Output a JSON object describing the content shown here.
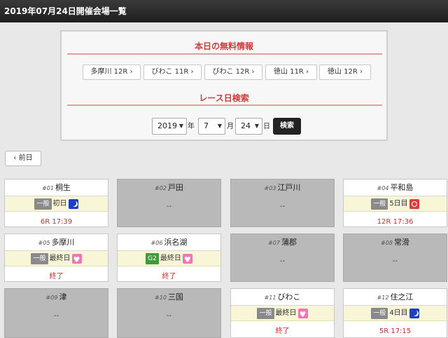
{
  "header": {
    "title": "2019年07月24日開催会場一覧"
  },
  "free_info": {
    "title": "本日の無料情報",
    "buttons": [
      "多摩川 12R",
      "びわこ 11R",
      "びわこ 12R",
      "徳山 11R",
      "徳山 12R"
    ],
    "chevron": "›"
  },
  "search": {
    "title": "レース日検索",
    "year": "2019",
    "year_unit": "年",
    "month": "7",
    "month_unit": "月",
    "day": "24",
    "day_unit": "日",
    "button": "検索"
  },
  "nav": {
    "prev_label": "前日",
    "prev_icon": "‹"
  },
  "venues": [
    {
      "num": "#01",
      "name": "桐生",
      "active": true,
      "grade": "一般",
      "day": "初日",
      "icon": "night-icon",
      "status": "6R 17:39"
    },
    {
      "num": "#02",
      "name": "戸田",
      "active": false,
      "dash": "--"
    },
    {
      "num": "#03",
      "name": "江戸川",
      "active": false,
      "dash": "--"
    },
    {
      "num": "#04",
      "name": "平和島",
      "active": true,
      "grade": "一般",
      "day": "5日目",
      "icon": "morning-icon",
      "status": "12R 17:36"
    },
    {
      "num": "#05",
      "name": "多摩川",
      "active": true,
      "grade": "一般",
      "day": "最終日",
      "icon": "lady-icon",
      "status": "終了"
    },
    {
      "num": "#06",
      "name": "浜名湖",
      "active": true,
      "grade": "G2",
      "day": "最終日",
      "icon": "lady-icon",
      "status": "終了"
    },
    {
      "num": "#07",
      "name": "蒲郡",
      "active": false,
      "dash": "--"
    },
    {
      "num": "#08",
      "name": "常滑",
      "active": false,
      "dash": "--"
    },
    {
      "num": "#09",
      "name": "津",
      "active": false,
      "dash": "--"
    },
    {
      "num": "#10",
      "name": "三国",
      "active": false,
      "dash": "--"
    },
    {
      "num": "#11",
      "name": "びわこ",
      "active": true,
      "grade": "一般",
      "day": "最終日",
      "icon": "lady-icon",
      "status": "終了"
    },
    {
      "num": "#12",
      "name": "住之江",
      "active": true,
      "grade": "一般",
      "day": "4日目",
      "icon": "night-icon",
      "status": "5R 17:15"
    }
  ]
}
